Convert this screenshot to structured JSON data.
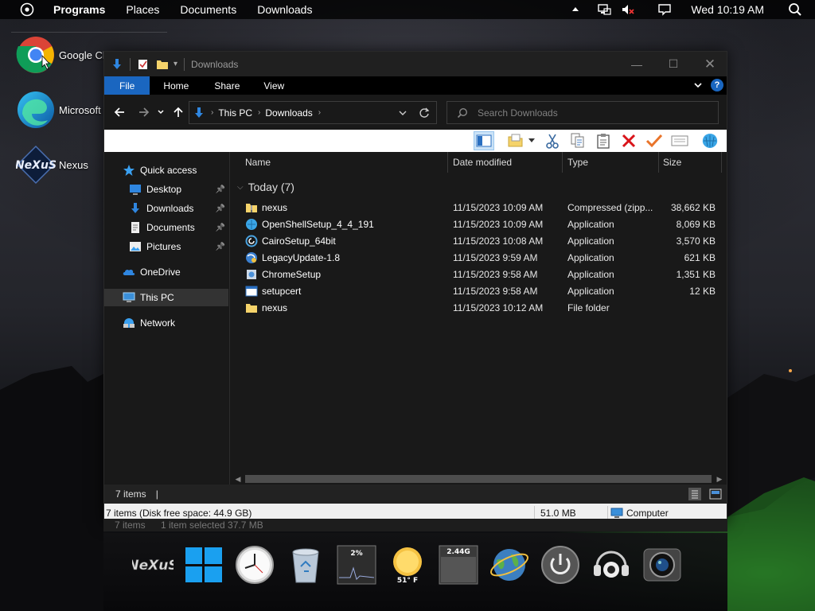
{
  "topbar": {
    "menus": [
      "Programs",
      "Places",
      "Documents",
      "Downloads"
    ],
    "clock": "Wed 10:19 AM",
    "tray_icons": [
      "chevron-up-icon",
      "network-icon",
      "volume-muted-icon",
      "notification-icon"
    ]
  },
  "desktop": {
    "icons": [
      {
        "label": "Google Chrome",
        "icon": "chrome-icon"
      },
      {
        "label": "Microsoft Edge",
        "icon": "edge-icon"
      },
      {
        "label": "Nexus",
        "icon": "nexus-icon"
      }
    ]
  },
  "window": {
    "title": "Downloads",
    "ribbon_tabs": [
      "File",
      "Home",
      "Share",
      "View"
    ],
    "help_label": "?",
    "address": {
      "crumbs": [
        "This PC",
        "Downloads"
      ]
    },
    "search_placeholder": "Search Downloads",
    "nav_pane": {
      "items": [
        {
          "label": "Quick access",
          "icon": "star-icon",
          "level": 0
        },
        {
          "label": "Desktop",
          "icon": "desktop-folder-icon",
          "level": 1,
          "pinned": true
        },
        {
          "label": "Downloads",
          "icon": "downloads-folder-icon",
          "level": 1,
          "pinned": true
        },
        {
          "label": "Documents",
          "icon": "documents-folder-icon",
          "level": 1,
          "pinned": true
        },
        {
          "label": "Pictures",
          "icon": "pictures-folder-icon",
          "level": 1,
          "pinned": true
        },
        {
          "label": "OneDrive",
          "icon": "onedrive-icon",
          "level": 0
        },
        {
          "label": "This PC",
          "icon": "computer-icon",
          "level": 0,
          "selected": true
        },
        {
          "label": "Network",
          "icon": "network-icon",
          "level": 0
        }
      ]
    },
    "columns": [
      "Name",
      "Date modified",
      "Type",
      "Size"
    ],
    "group_label": "Today (7)",
    "files": [
      {
        "name": "nexus",
        "date": "11/15/2023 10:09 AM",
        "type": "Compressed (zipp...",
        "size": "38,662 KB",
        "icon": "zip-folder-icon"
      },
      {
        "name": "OpenShellSetup_4_4_191",
        "date": "11/15/2023 10:09 AM",
        "type": "Application",
        "size": "8,069 KB",
        "icon": "openshell-icon"
      },
      {
        "name": "CairoSetup_64bit",
        "date": "11/15/2023 10:08 AM",
        "type": "Application",
        "size": "3,570 KB",
        "icon": "cairo-icon"
      },
      {
        "name": "LegacyUpdate-1.8",
        "date": "11/15/2023 9:59 AM",
        "type": "Application",
        "size": "621 KB",
        "icon": "legacyupdate-icon"
      },
      {
        "name": "ChromeSetup",
        "date": "11/15/2023 9:58 AM",
        "type": "Application",
        "size": "1,351 KB",
        "icon": "installer-icon"
      },
      {
        "name": "setupcert",
        "date": "11/15/2023 9:58 AM",
        "type": "Application",
        "size": "12 KB",
        "icon": "app-window-icon"
      },
      {
        "name": "nexus",
        "date": "11/15/2023 10:12 AM",
        "type": "File folder",
        "size": "",
        "icon": "folder-icon"
      }
    ],
    "status_items": "7 items",
    "status_sep": "|",
    "infobar": {
      "left": "7 items (Disk free space: 44.9 GB)",
      "middle": "51.0 MB",
      "right": "Computer"
    },
    "ghost_status": {
      "items": "7 items",
      "selected": "1 item selected  37.7 MB"
    }
  },
  "dock": {
    "items": [
      "nexus-logo-icon",
      "windows-logo-icon",
      "clock-icon",
      "recycle-bin-icon",
      "cpu-meter-icon",
      "weather-icon",
      "memory-meter-icon",
      "internet-globe-icon",
      "power-icon",
      "media-player-icon",
      "camera-icon"
    ],
    "cpu_label": "2%",
    "weather_label": "51° F",
    "memory_label": "2.44G"
  },
  "colors": {
    "accent": "#1a66c0",
    "window_bg": "#191919",
    "close_red": "#d9141a",
    "check_orange": "#e9742a"
  }
}
